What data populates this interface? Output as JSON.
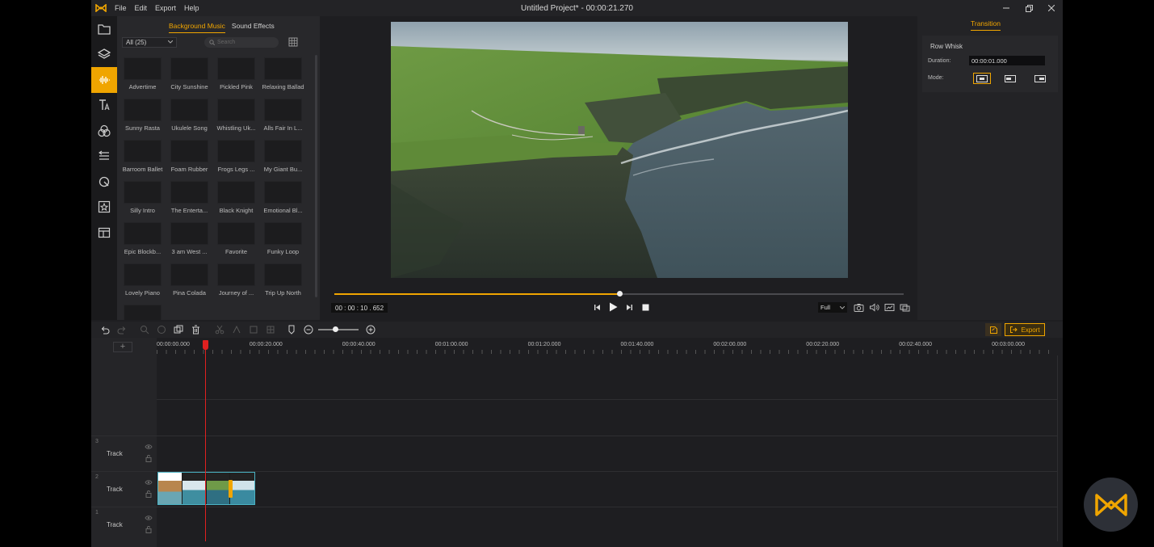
{
  "window": {
    "title": "Untitled Project* - 00:00:21.270",
    "menu": [
      "File",
      "Edit",
      "Export",
      "Help"
    ]
  },
  "media": {
    "tabs": [
      "Background Music",
      "Sound Effects"
    ],
    "filter": "All (25)",
    "search_placeholder": "Search",
    "items": [
      "Advertime",
      "City Sunshine",
      "Pickled Pink",
      "Relaxing Ballad",
      "Sunny Rasta",
      "Ukulele Song",
      "Whistling Uk...",
      "Alls Fair In L...",
      "Barroom Ballet",
      "Foam Rubber",
      "Frogs Legs ...",
      "My Giant Bu...",
      "Silly Intro",
      "The Enterta...",
      "Black Knight",
      "Emotional Bl...",
      "Epic Blockb...",
      "3 am West ...",
      "Favorite",
      "Funky Loop",
      "Lovely Piano",
      "Pina Colada",
      "Journey of ...",
      "Trip Up North"
    ]
  },
  "preview": {
    "time": "00 : 00 : 10 . 652",
    "progress": 0.5,
    "quality": "Full"
  },
  "properties": {
    "tab": "Transition",
    "name": "Row Whisk",
    "duration_label": "Duration:",
    "duration": "00:00:01.000",
    "mode_label": "Mode:",
    "active_mode": 0
  },
  "timeline": {
    "export_label": "Export",
    "zoom": 0.42,
    "ruler": [
      "00:00:00.000",
      "00:00:20.000",
      "00:00:40.000",
      "00:01:00.000",
      "00:01:20.000",
      "00:01:40.000",
      "00:02:00.000",
      "00:02:20.000",
      "00:02:40.000",
      "00:03:00.000"
    ],
    "tracks": [
      {
        "num": "3",
        "name": "Track"
      },
      {
        "num": "2",
        "name": "Track"
      },
      {
        "num": "1",
        "name": "Track"
      }
    ]
  },
  "colors": {
    "accent": "#f0a500",
    "playhead": "#e02020",
    "clip": "#2a6f7d"
  }
}
